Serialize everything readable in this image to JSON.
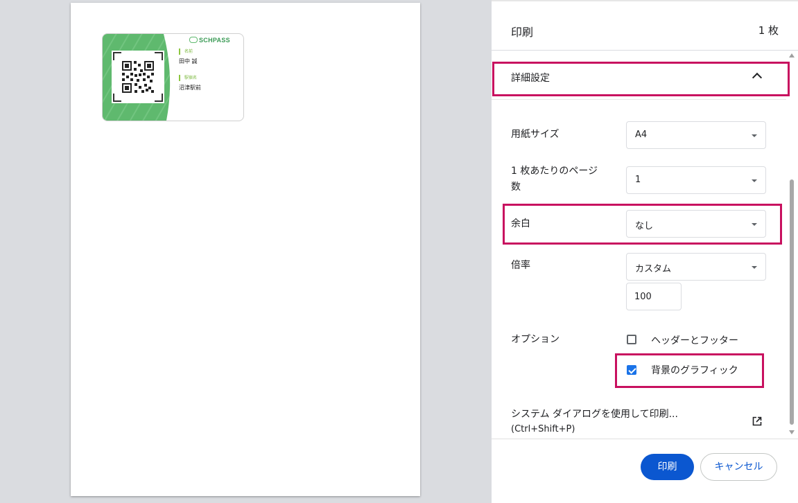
{
  "preview": {
    "card": {
      "brand": "SCHPASS",
      "name_label": "名前",
      "name_value": "田中 誠",
      "station_label": "駅宿名",
      "station_value": "沼津駅前"
    }
  },
  "panel": {
    "title": "印刷",
    "sheet_count": "1 枚",
    "advanced_settings": "詳細設定",
    "paper_size": {
      "label": "用紙サイズ",
      "value": "A4"
    },
    "pages_per_sheet": {
      "label_line1": "1 枚あたりのページ",
      "label_line2": "数",
      "value": "1"
    },
    "margins": {
      "label": "余白",
      "value": "なし"
    },
    "scale": {
      "label": "倍率",
      "value": "カスタム",
      "custom_value": "100"
    },
    "options": {
      "label": "オプション",
      "headers_footers": {
        "label": "ヘッダーとフッター",
        "checked": false
      },
      "background_graphics": {
        "label": "背景のグラフィック",
        "checked": true
      }
    },
    "system_dialog": {
      "label": "システム ダイアログを使用して印刷...",
      "shortcut": "(Ctrl+Shift+P)"
    },
    "buttons": {
      "print": "印刷",
      "cancel": "キャンセル"
    }
  },
  "colors": {
    "accent": "#0b57d0",
    "highlight": "#c8105f",
    "card_green": "#5fb96e"
  }
}
